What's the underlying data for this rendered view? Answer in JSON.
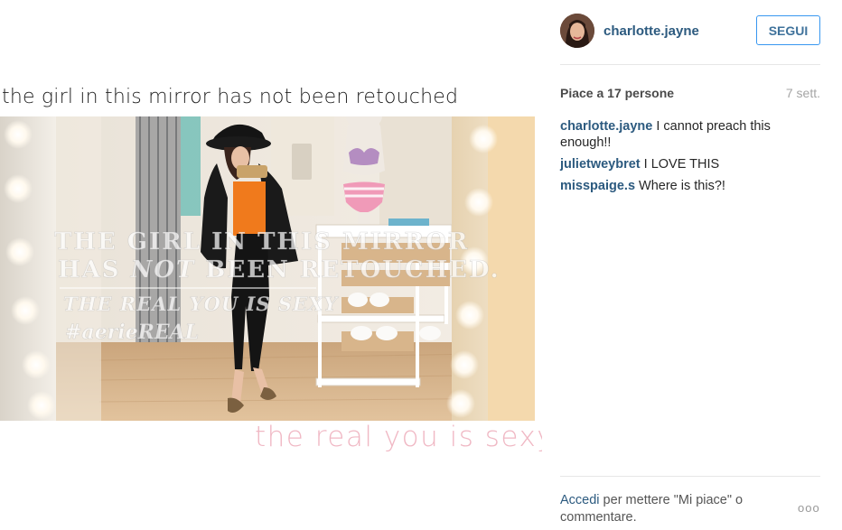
{
  "media": {
    "caption_top": "the girl in this mirror has not been retouched",
    "caption_bottom": "the real you is sexy",
    "overlay_line1": "THE GIRL IN THIS MIRROR",
    "overlay_line2_a": "HAS ",
    "overlay_line2_b": "NOT",
    "overlay_line2_c": " BEEN RETOUCHED.",
    "overlay_line3": "THE REAL YOU IS SEXY",
    "overlay_line4": "#aerieREAL"
  },
  "post": {
    "username": "charlotte.jayne",
    "follow_label": "SEGUI",
    "likes_text": "Piace a 17 persone",
    "time_text": "7 sett."
  },
  "comments": [
    {
      "user": "charlotte.jayne",
      "text": "I cannot preach this enough!!"
    },
    {
      "user": "julietweybret",
      "text": "I LOVE THIS"
    },
    {
      "user": "misspaige.s",
      "text": "Where is this?!"
    }
  ],
  "login": {
    "link_label": "Accedi",
    "rest_text": " per mettere \"Mi piace\" o commentare.",
    "more_label": "ooo"
  },
  "colors": {
    "link": "#2c5a7f",
    "follow_border": "#3897f0",
    "caption_pink": "#f0b8c4"
  }
}
